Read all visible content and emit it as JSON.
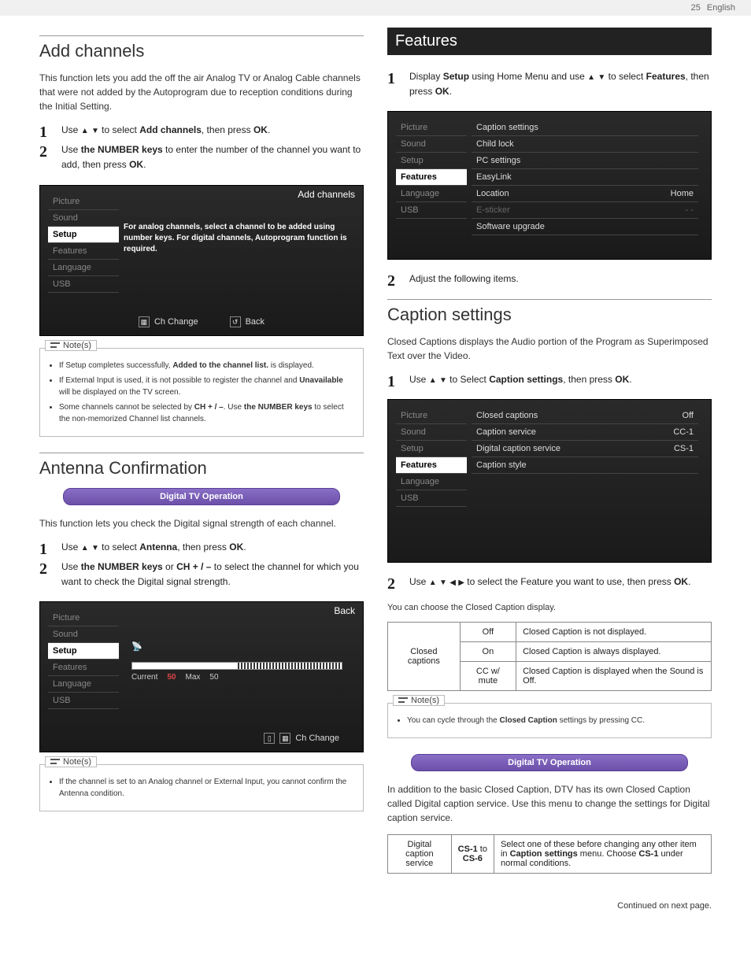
{
  "page": {
    "number": "25",
    "lang": "English",
    "continued": "Continued on next page."
  },
  "left": {
    "add_channels": {
      "title": "Add channels",
      "intro": "This function lets you add the off the air Analog TV or Analog Cable channels that were not added by the Autoprogram due to reception conditions during the Initial Setting.",
      "step1_a": "Use ",
      "step1_b": " to select ",
      "step1_c": "Add channels",
      "step1_d": ", then press ",
      "step1_e": "OK",
      "step1_f": ".",
      "step2_a": "Use ",
      "step2_b": "the NUMBER keys",
      "step2_c": " to enter the number of the channel you want to add, then press ",
      "step2_d": "OK",
      "step2_e": ".",
      "osd": {
        "corner": "Add channels",
        "side": [
          "Picture",
          "Sound",
          "Setup",
          "Features",
          "Language",
          "USB"
        ],
        "active_index": 2,
        "note": "For analog channels, select a channel to be added using number keys. For digital channels, Autoprogram function is required.",
        "footer": {
          "ch": "Ch Change",
          "back": "Back"
        }
      },
      "notes_label": "Note(s)",
      "notes": [
        {
          "a": "If Setup completes successfully, ",
          "b": "Added to the channel list.",
          "c": " is displayed."
        },
        {
          "a": "If External Input is used, it is not possible to register the channel and ",
          "b": "Unavailable",
          "c": " will be displayed on the TV screen."
        },
        {
          "a": "Some channels cannot be selected by ",
          "b": "CH + / –",
          "c": ". Use ",
          "d": "the NUMBER keys",
          "e": " to select the non-memorized Channel list channels."
        }
      ]
    },
    "antenna": {
      "title": "Antenna Confirmation",
      "purple": "Digital TV Operation",
      "intro": "This function lets you check the Digital signal strength of each channel.",
      "step1_a": "Use ",
      "step1_b": " to select ",
      "step1_c": "Antenna",
      "step1_d": ", then press ",
      "step1_e": "OK",
      "step1_f": ".",
      "step2_a": "Use ",
      "step2_b": "the NUMBER keys",
      "step2_c": " or ",
      "step2_d": "CH + / –",
      "step2_e": " to select the channel for which you want to check the Digital signal strength.",
      "osd": {
        "corner": "Back",
        "side": [
          "Picture",
          "Sound",
          "Setup",
          "Features",
          "Language",
          "USB"
        ],
        "active_index": 2,
        "signal": {
          "current": "Current",
          "val1": "50",
          "max": "Max",
          "val2": "50"
        },
        "footer": {
          "ch": "Ch Change"
        }
      },
      "notes_label": "Note(s)",
      "notes": [
        "If the channel is set to an Analog channel or External Input, you cannot confirm the Antenna condition."
      ]
    }
  },
  "right": {
    "features": {
      "title": "Features",
      "step1_a": "Display ",
      "step1_b": "Setup",
      "step1_c": " using Home Menu and use ",
      "step1_d": " to select ",
      "step1_e": "Features",
      "step1_f": ", then press ",
      "step1_g": "OK",
      "step1_h": ".",
      "osd": {
        "side": [
          "Picture",
          "Sound",
          "Setup",
          "Features",
          "Language",
          "USB"
        ],
        "active_index": 3,
        "items": [
          {
            "l": "Caption settings",
            "r": ""
          },
          {
            "l": "Child lock",
            "r": ""
          },
          {
            "l": "PC settings",
            "r": ""
          },
          {
            "l": "EasyLink",
            "r": ""
          },
          {
            "l": "Location",
            "r": "Home"
          },
          {
            "l": "E-sticker",
            "r": "- -",
            "dim": true
          },
          {
            "l": "Software upgrade",
            "r": ""
          }
        ]
      },
      "step2": "Adjust the following items."
    },
    "caption": {
      "title": "Caption settings",
      "intro": "Closed Captions displays the Audio portion of the Program as Superimposed Text over the Video.",
      "step1_a": "Use ",
      "step1_b": " to Select ",
      "step1_c": "Caption settings",
      "step1_d": ", then press ",
      "step1_e": "OK",
      "step1_f": ".",
      "osd": {
        "side": [
          "Picture",
          "Sound",
          "Setup",
          "Features",
          "Language",
          "USB"
        ],
        "active_index": 3,
        "items": [
          {
            "l": "Closed captions",
            "r": "Off"
          },
          {
            "l": "Caption service",
            "r": "CC-1"
          },
          {
            "l": "Digital caption service",
            "r": "CS-1"
          },
          {
            "l": "Caption style",
            "r": ""
          }
        ]
      },
      "step2_a": "Use ",
      "step2_b": " to select the Feature you want to use, then press ",
      "step2_c": "OK",
      "step2_d": ".",
      "table_intro": "You can choose the Closed Caption display.",
      "cc_table": {
        "rowhead": "Closed captions",
        "rows": [
          {
            "k": "Off",
            "v": "Closed Caption is not displayed."
          },
          {
            "k": "On",
            "v": "Closed Caption is always displayed."
          },
          {
            "k": "CC w/ mute",
            "v": "Closed Caption is displayed when the Sound is Off."
          }
        ]
      },
      "notes_label": "Note(s)",
      "note1_a": "You can cycle through the ",
      "note1_b": "Closed Caption",
      "note1_c": " settings by pressing CC.",
      "purple": "Digital TV Operation",
      "dtv_intro": "In addition to the basic Closed Caption, DTV has its own Closed Caption called Digital caption service. Use this menu to change the settings for Digital caption service.",
      "dcs_table": {
        "rowhead": "Digital caption service",
        "range_a": "CS-1",
        "range_b": " to ",
        "range_c": "CS-6",
        "desc_a": "Select one of these before changing any other item in ",
        "desc_b": "Caption settings",
        "desc_c": " menu. Choose ",
        "desc_d": "CS-1",
        "desc_e": " under normal conditions."
      }
    }
  }
}
